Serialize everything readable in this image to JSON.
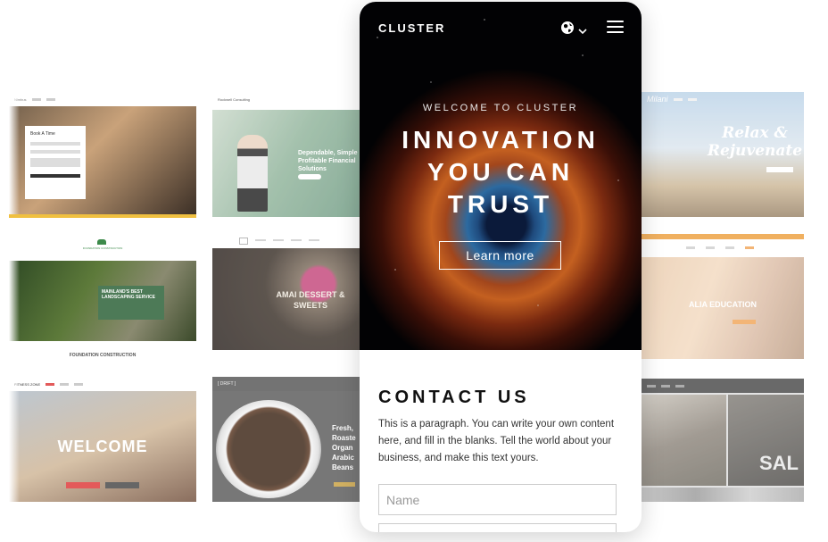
{
  "tiles": {
    "car": {
      "form_title": "Book A Time",
      "nav_brand": "Nimbus"
    },
    "business": {
      "nav_brand": "Rockwell Consulting",
      "heading": "Dependable, Simple Profitable Financial Solutions"
    },
    "foundation": {
      "brand": "FOUNDATION CONSTRUCTION",
      "banner": "MAINLAND'S BEST LANDSCAPING SERVICE",
      "footer": "FOUNDATION CONSTRUCTION"
    },
    "dessert": {
      "heading": "AMAI DESSERT & SWEETS"
    },
    "fitness": {
      "nav_brand": "FITNESS ZONE",
      "heading": "WELCOME"
    },
    "coffee": {
      "nav_brand": "[ DRIFT ]",
      "heading": "Fresh, Roaste Organ Arabic Beans"
    },
    "spa": {
      "nav_brand": "Milani",
      "heading": "Relax & Rejuvenate"
    },
    "education": {
      "heading": "ALIA EDUCATION"
    },
    "shop": {
      "heading": "SAL"
    }
  },
  "phone": {
    "brand": "CLUSTER",
    "welcome": "WELCOME TO CLUSTER",
    "headline_line1": "INNOVATION",
    "headline_line2": "YOU CAN",
    "headline_line3": "TRUST",
    "cta": "Learn more",
    "contact_title": "CONTACT US",
    "paragraph": "This is a paragraph. You can write your own content here, and fill in the blanks. Tell the world about your business, and make this text yours.",
    "name_placeholder": "Name"
  },
  "icons": {
    "globe": "globe-icon",
    "menu": "hamburger-menu-icon",
    "chevron": "chevron-down-icon"
  }
}
